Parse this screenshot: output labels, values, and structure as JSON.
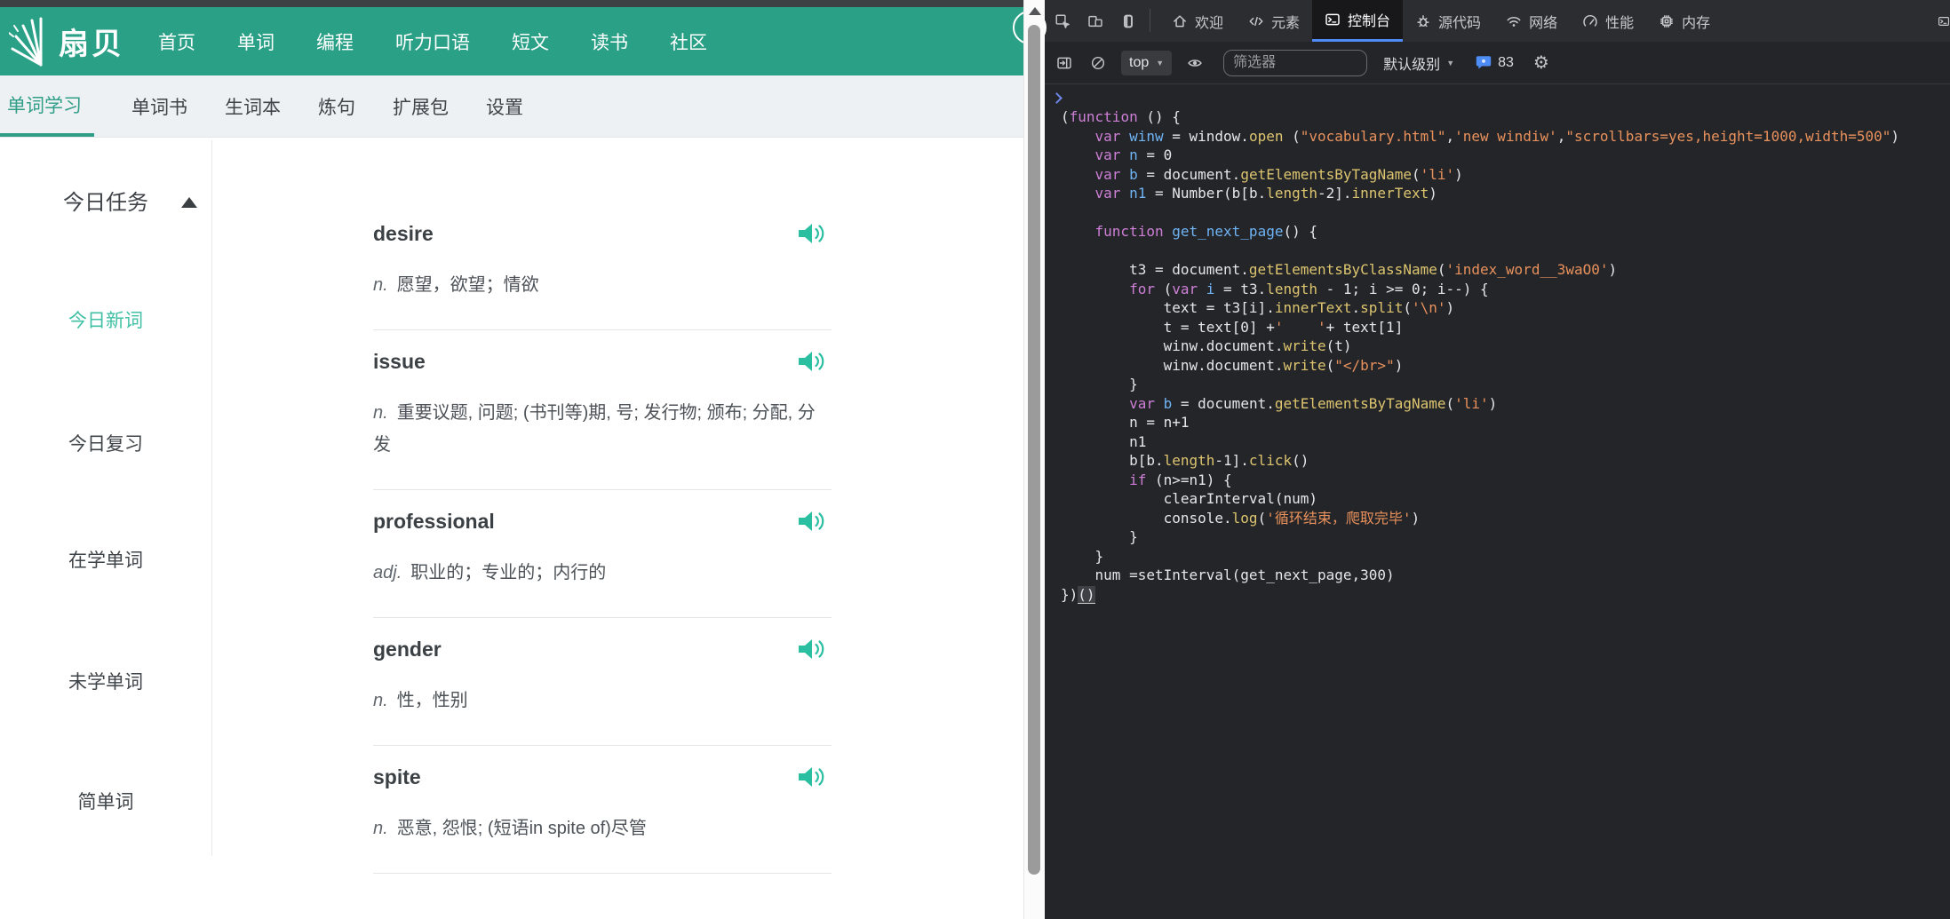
{
  "site": {
    "brand": "扇贝",
    "top_nav": [
      "首页",
      "单词",
      "编程",
      "听力口语",
      "短文",
      "读书",
      "社区"
    ],
    "sub_nav": [
      {
        "label": "单词学习",
        "active": true
      },
      {
        "label": "单词书",
        "active": false
      },
      {
        "label": "生词本",
        "active": false
      },
      {
        "label": "炼句",
        "active": false
      },
      {
        "label": "扩展包",
        "active": false
      },
      {
        "label": "设置",
        "active": false
      }
    ],
    "sidebar": {
      "title": "今日任务",
      "collapse_icon": "caret-up-icon",
      "items": [
        {
          "label": "今日新词",
          "active": true
        },
        {
          "label": "今日复习",
          "active": false
        },
        {
          "label": "在学单词",
          "active": false
        },
        {
          "label": "未学单词",
          "active": false
        },
        {
          "label": "简单词",
          "active": false
        }
      ]
    },
    "words": [
      {
        "word": "desire",
        "pos": "n.",
        "def": "愿望，欲望；情欲",
        "audio_icon": "speaker-icon"
      },
      {
        "word": "issue",
        "pos": "n.",
        "def": "重要议题, 问题; (书刊等)期, 号; 发行物; 颁布; 分配, 分发",
        "audio_icon": "speaker-icon"
      },
      {
        "word": "professional",
        "pos": "adj.",
        "def": "职业的；专业的；内行的",
        "audio_icon": "speaker-icon"
      },
      {
        "word": "gender",
        "pos": "n.",
        "def": "性，性别",
        "audio_icon": "speaker-icon"
      },
      {
        "word": "spite",
        "pos": "n.",
        "def": "恶意, 怨恨; (短语in spite of)尽管",
        "audio_icon": "speaker-icon"
      }
    ],
    "colors": {
      "brand_teal": "#2aa086",
      "active_link": "#41c0a5",
      "speaker_teal": "#2bbfa2"
    }
  },
  "devtools": {
    "left_icons": [
      "inspect",
      "devices",
      "screencast"
    ],
    "tabs": [
      {
        "label": "欢迎",
        "icon": "home",
        "active": false
      },
      {
        "label": "元素",
        "icon": "elements",
        "active": false
      },
      {
        "label": "控制台",
        "icon": "console",
        "active": true
      },
      {
        "label": "源代码",
        "icon": "sources",
        "active": false
      },
      {
        "label": "网络",
        "icon": "network",
        "active": false
      },
      {
        "label": "性能",
        "icon": "performance",
        "active": false
      },
      {
        "label": "内存",
        "icon": "memory",
        "active": false
      }
    ],
    "toolbar": {
      "icons_left": [
        "sidebar-toggle",
        "clear-console"
      ],
      "context": "top",
      "eye_icon": "live-expression-eye",
      "filter_placeholder": "筛选器",
      "level_label": "默认级别",
      "badge_icon": "messages-bubble",
      "message_count": "83",
      "gear_icon": "settings-gear"
    },
    "colors": {
      "accent_blue": "#4e8df6",
      "keyword": "#cd7fd6",
      "variable": "#6fb4f5",
      "property": "#ddc56f",
      "string": "#e8915c",
      "background": "#242529"
    },
    "console_lines": [
      [
        [
          "(",
          "p"
        ],
        [
          "function",
          "k"
        ],
        [
          " () {",
          "p"
        ]
      ],
      [
        [
          "    ",
          "p"
        ],
        [
          "var",
          "k"
        ],
        [
          " ",
          "p"
        ],
        [
          "winw",
          "v"
        ],
        [
          " = window.",
          "p"
        ],
        [
          "open",
          "f"
        ],
        [
          " (",
          "p"
        ],
        [
          "\"vocabulary.html\"",
          "s"
        ],
        [
          ",",
          "p"
        ],
        [
          "'new windiw'",
          "s"
        ],
        [
          ",",
          "p"
        ],
        [
          "\"scrollbars=yes,height=1000,width=500\"",
          "s"
        ],
        [
          ")",
          "p"
        ]
      ],
      [
        [
          "    ",
          "p"
        ],
        [
          "var",
          "k"
        ],
        [
          " ",
          "p"
        ],
        [
          "n",
          "v"
        ],
        [
          " = 0",
          "p"
        ]
      ],
      [
        [
          "    ",
          "p"
        ],
        [
          "var",
          "k"
        ],
        [
          " ",
          "p"
        ],
        [
          "b",
          "v"
        ],
        [
          " = document.",
          "p"
        ],
        [
          "getElementsByTagName",
          "f"
        ],
        [
          "(",
          "p"
        ],
        [
          "'li'",
          "s"
        ],
        [
          ")",
          "p"
        ]
      ],
      [
        [
          "    ",
          "p"
        ],
        [
          "var",
          "k"
        ],
        [
          " ",
          "p"
        ],
        [
          "n1",
          "v"
        ],
        [
          " = Number(b[b.",
          "p"
        ],
        [
          "length",
          "f"
        ],
        [
          "-2].",
          "p"
        ],
        [
          "innerText",
          "f"
        ],
        [
          ")",
          "p"
        ]
      ],
      [],
      [
        [
          "    ",
          "p"
        ],
        [
          "function",
          "k"
        ],
        [
          " ",
          "p"
        ],
        [
          "get_next_page",
          "v"
        ],
        [
          "() {",
          "p"
        ]
      ],
      [],
      [
        [
          "        t3 = document.",
          "p"
        ],
        [
          "getElementsByClassName",
          "f"
        ],
        [
          "(",
          "p"
        ],
        [
          "'index_word__3waO0'",
          "s"
        ],
        [
          ")",
          "p"
        ]
      ],
      [
        [
          "        ",
          "p"
        ],
        [
          "for",
          "k"
        ],
        [
          " (",
          "p"
        ],
        [
          "var",
          "k"
        ],
        [
          " ",
          "p"
        ],
        [
          "i",
          "v"
        ],
        [
          " = t3.",
          "p"
        ],
        [
          "length",
          "f"
        ],
        [
          " - 1; i >= 0; i--) {",
          "p"
        ]
      ],
      [
        [
          "            text = t3[i].",
          "p"
        ],
        [
          "innerText",
          "f"
        ],
        [
          ".",
          "p"
        ],
        [
          "split",
          "f"
        ],
        [
          "(",
          "p"
        ],
        [
          "'\\n'",
          "s"
        ],
        [
          ")",
          "p"
        ]
      ],
      [
        [
          "            t = text[0] +",
          "p"
        ],
        [
          "'    '",
          "s"
        ],
        [
          "+ text[1]",
          "p"
        ]
      ],
      [
        [
          "            winw.document.",
          "p"
        ],
        [
          "write",
          "f"
        ],
        [
          "(t)",
          "p"
        ]
      ],
      [
        [
          "            winw.document.",
          "p"
        ],
        [
          "write",
          "f"
        ],
        [
          "(",
          "p"
        ],
        [
          "\"</br>\"",
          "s"
        ],
        [
          ")",
          "p"
        ]
      ],
      [
        [
          "        }",
          "p"
        ]
      ],
      [
        [
          "        ",
          "p"
        ],
        [
          "var",
          "k"
        ],
        [
          " ",
          "p"
        ],
        [
          "b",
          "v"
        ],
        [
          " = document.",
          "p"
        ],
        [
          "getElementsByTagName",
          "f"
        ],
        [
          "(",
          "p"
        ],
        [
          "'li'",
          "s"
        ],
        [
          ")",
          "p"
        ]
      ],
      [
        [
          "        n = n+1",
          "p"
        ]
      ],
      [
        [
          "        n1",
          "p"
        ]
      ],
      [
        [
          "        b[b.",
          "p"
        ],
        [
          "length",
          "f"
        ],
        [
          "-1].",
          "p"
        ],
        [
          "click",
          "f"
        ],
        [
          "()",
          "p"
        ]
      ],
      [
        [
          "        ",
          "p"
        ],
        [
          "if",
          "k"
        ],
        [
          " (n>=n1) {",
          "p"
        ]
      ],
      [
        [
          "            clearInterval(num)",
          "p"
        ]
      ],
      [
        [
          "            console.",
          "p"
        ],
        [
          "log",
          "f"
        ],
        [
          "(",
          "p"
        ],
        [
          "'循环结束，爬取完毕'",
          "s"
        ],
        [
          ")",
          "p"
        ]
      ],
      [
        [
          "        }",
          "p"
        ]
      ],
      [
        [
          "    }",
          "p"
        ]
      ],
      [
        [
          "    num =setInterval(get_next_page,300)",
          "p"
        ]
      ],
      [
        [
          "})",
          "p"
        ],
        [
          "()",
          "u"
        ]
      ]
    ]
  }
}
